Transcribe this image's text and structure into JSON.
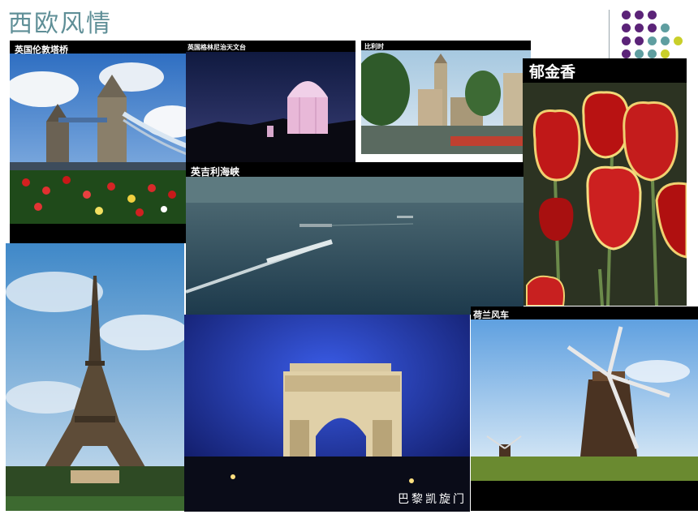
{
  "slide": {
    "title": "西欧风情",
    "accent_colors": [
      "#5b2378",
      "#5f9ea0",
      "#c9cf2a"
    ]
  },
  "photos": [
    {
      "id": "tower-bridge",
      "caption": "英国伦敦塔桥"
    },
    {
      "id": "greenwich",
      "caption": "英国格林尼治天文台"
    },
    {
      "id": "belgium",
      "caption": "比利时"
    },
    {
      "id": "tulip",
      "caption": "郁金香"
    },
    {
      "id": "strait",
      "caption": "英吉利海峡"
    },
    {
      "id": "eiffel",
      "caption": ""
    },
    {
      "id": "arc",
      "caption": "巴黎凯旋门"
    },
    {
      "id": "windmill",
      "caption": "荷兰风车"
    }
  ]
}
